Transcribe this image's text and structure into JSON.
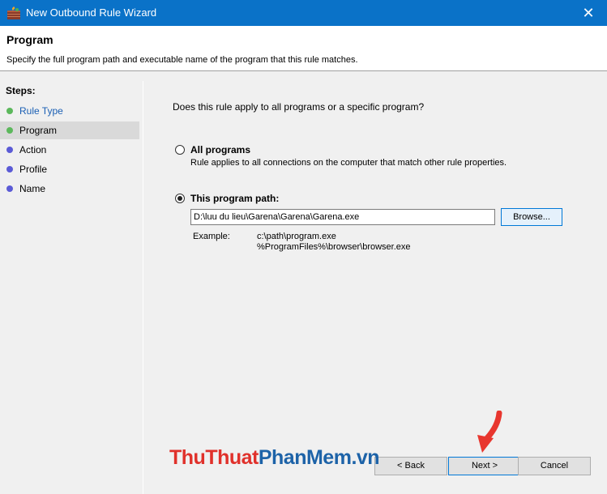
{
  "window": {
    "title": "New Outbound Rule Wizard",
    "close_glyph": "✕",
    "icon": "firewall-icon"
  },
  "header": {
    "title": "Program",
    "description": "Specify the full program path and executable name of the program that this rule matches."
  },
  "steps": {
    "title": "Steps:",
    "items": [
      {
        "label": "Rule Type",
        "state": "completed",
        "color": "#5cb85c"
      },
      {
        "label": "Program",
        "state": "current",
        "color": "#5cb85c"
      },
      {
        "label": "Action",
        "state": "pending",
        "color": "#5b5bd6"
      },
      {
        "label": "Profile",
        "state": "pending",
        "color": "#5b5bd6"
      },
      {
        "label": "Name",
        "state": "pending",
        "color": "#5b5bd6"
      }
    ]
  },
  "content": {
    "question": "Does this rule apply to all programs or a specific program?",
    "options": [
      {
        "label": "All programs",
        "description": "Rule applies to all connections on the computer that match other rule properties.",
        "checked": false
      },
      {
        "label": "This program path:",
        "checked": true
      }
    ],
    "path_value": "D:\\luu du lieu\\Garena\\Garena\\Garena.exe",
    "browse_label": "Browse...",
    "example_label": "Example:",
    "example_values": [
      "c:\\path\\program.exe",
      "%ProgramFiles%\\browser\\browser.exe"
    ]
  },
  "buttons": {
    "back": "< Back",
    "next": "Next >",
    "cancel": "Cancel"
  },
  "watermark": {
    "part1": "ThuThuat",
    "part2": "PhanMem",
    "part3": ".vn"
  },
  "colors": {
    "titlebar": "#0a72c8",
    "accent": "#0078d7",
    "arrow": "#e8362e"
  }
}
